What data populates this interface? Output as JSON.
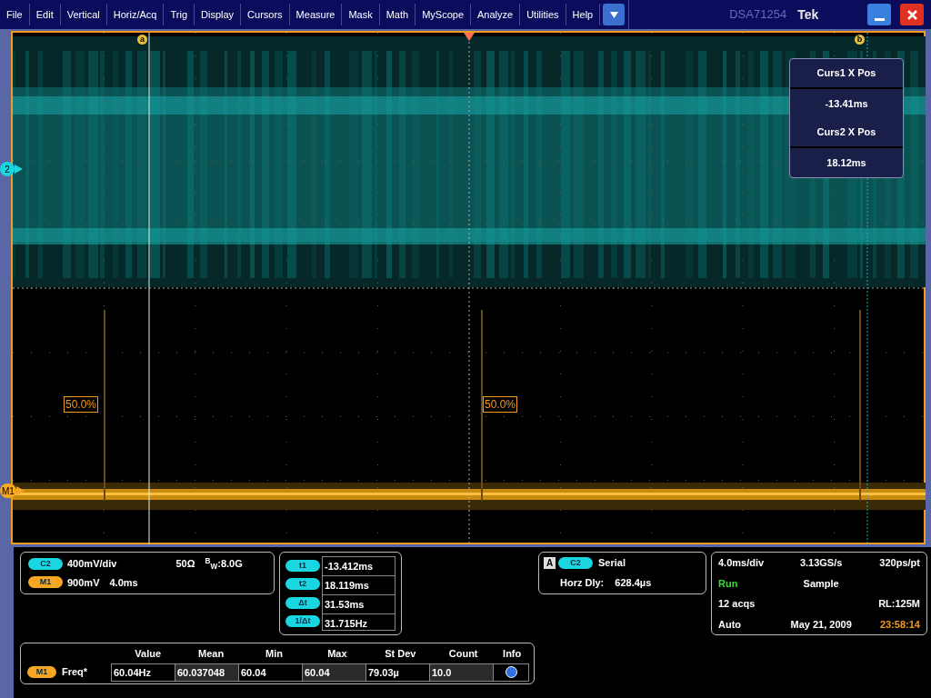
{
  "menu": {
    "items": [
      "File",
      "Edit",
      "Vertical",
      "Horiz/Acq",
      "Trig",
      "Display",
      "Cursors",
      "Measure",
      "Mask",
      "Math",
      "MyScope",
      "Analyze",
      "Utilities",
      "Help"
    ],
    "model": "DSA71254",
    "brand": "Tek"
  },
  "scope": {
    "cursor_labels": [
      "a",
      "b"
    ],
    "markers": [
      {
        "label": "2",
        "color": "#19d6e0"
      },
      {
        "label": "M1",
        "color": "#f5a623"
      }
    ],
    "ref_labels": [
      "50.0%",
      "50.0%"
    ],
    "readout": [
      {
        "label": "Curs1 X Pos",
        "value": "-13.41ms"
      },
      {
        "label": "Curs2 X Pos",
        "value": "18.12ms"
      }
    ]
  },
  "channel_panel": {
    "rows": [
      {
        "badge": "C2",
        "color": "#19d6e0",
        "texts": [
          "400mV/div",
          "50Ω"
        ],
        "bw": "$^{B}$$_{W}$:8.0G"
      },
      {
        "badge": "M1",
        "color": "#f5a623",
        "texts": [
          "900mV",
          "4.0ms"
        ]
      }
    ]
  },
  "cursor_panel": [
    {
      "badge": "t1",
      "value": "-13.412ms"
    },
    {
      "badge": "t2",
      "value": "18.119ms"
    },
    {
      "badge": "Δt",
      "value": "31.53ms"
    },
    {
      "badge": "1/Δt",
      "value": "31.715Hz"
    }
  ],
  "trigger_panel": {
    "mode": "A",
    "badge": "C2",
    "type": "Serial",
    "delay_label": "Horz Dly:",
    "delay": "628.4µs"
  },
  "acq_panel": {
    "rows": [
      {
        "left": "4.0ms/div",
        "center": "3.13GS/s",
        "right": "320ps/pt"
      },
      {
        "left": "Run",
        "center": "Sample"
      },
      {
        "left": "12 acqs",
        "right": "RL:125M"
      },
      {
        "left": "Auto",
        "center": "May 21, 2009",
        "right": "23:58:14"
      }
    ],
    "running": true
  },
  "measurements": {
    "columns": [
      "Value",
      "Mean",
      "Min",
      "Max",
      "St Dev",
      "Count",
      "Info"
    ],
    "rows": [
      {
        "badge": "M1",
        "name": "Freq*",
        "cells": [
          "60.04Hz",
          "60.037048",
          "60.04",
          "60.04",
          "79.03µ",
          "10.0"
        ]
      }
    ]
  }
}
